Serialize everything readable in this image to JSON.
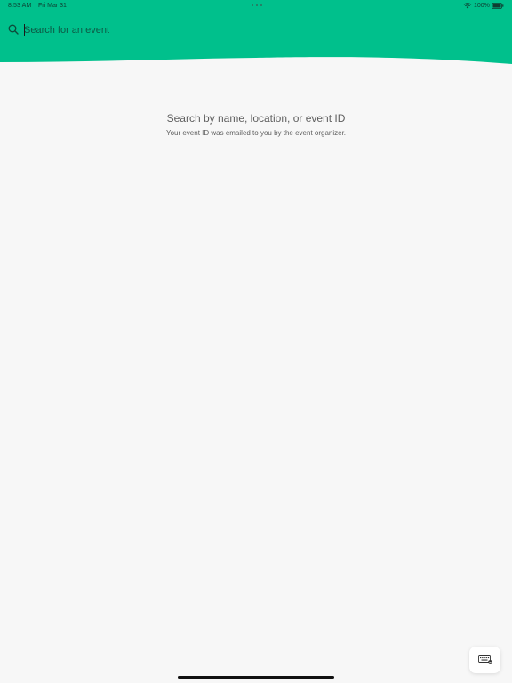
{
  "status_bar": {
    "time": "8:53 AM",
    "date": "Fri Mar 31",
    "battery": "100%",
    "icons": [
      "wifi-icon",
      "battery-icon"
    ]
  },
  "header": {
    "accent_color": "#00c08c",
    "search": {
      "value": "",
      "placeholder": "Search for an event",
      "icon": "search-icon"
    }
  },
  "empty_state": {
    "title": "Search by name, location, or event ID",
    "subtitle": "Your event ID was emailed to you by the event organizer."
  },
  "keyboard_button": {
    "icon": "keyboard-dismiss-icon"
  }
}
